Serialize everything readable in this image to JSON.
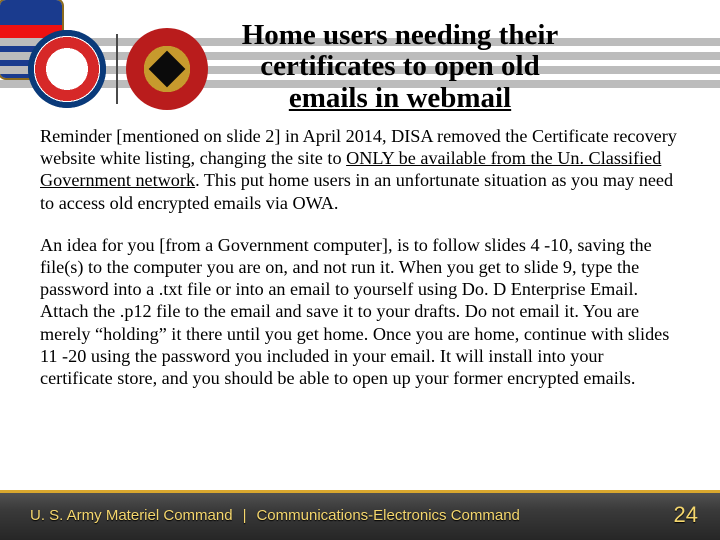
{
  "title": {
    "line1": "Home users needing their",
    "line2": "certificates to open old",
    "line3_underlined": "emails in webmail"
  },
  "body": {
    "para1_pre": "Reminder [mentioned on slide 2] in April 2014, DISA removed the Certificate recovery website white listing, changing the site to ",
    "para1_underlined": "ONLY be available from the Un. Classified Government network",
    "para1_post": ".  This put home users in an unfortunate situation as you may need to access old encrypted emails via OWA.",
    "para2": "An idea for you [from a Government computer], is to follow slides 4 -10, saving the file(s) to the computer you are on, and not run it.  When you get to slide 9, type the password into a .txt file or into an email to yourself using Do. D Enterprise Email.  Attach the .p12 file to the email and save it to your drafts.  Do not email it.  You are merely “holding” it there until you get home.  Once you are home, continue with slides 11 -20 using the password you included in your email.  It will install into your certificate store, and you should be able to open up your former encrypted emails."
  },
  "footer": {
    "left": "U. S. Army Materiel Command",
    "sep": "|",
    "center": "Communications-Electronics Command",
    "page": "24"
  },
  "icons": {
    "left": "amc-shield-icon",
    "mid": "cecom-seal-icon",
    "right": "unit-crest-icon"
  }
}
